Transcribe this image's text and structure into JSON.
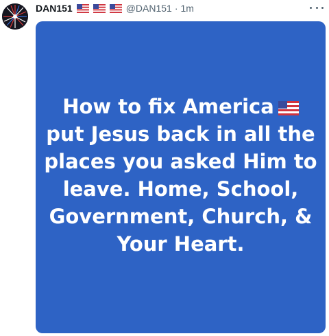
{
  "tweet": {
    "display_name": "DAN151",
    "name_badges": [
      "us-flag-icon",
      "us-flag-icon",
      "us-flag-icon"
    ],
    "handle": "@DAN151",
    "separator": "·",
    "timestamp": "1m",
    "more_icon": "more-horizontal-icon",
    "avatar_icon": "fireworks-avatar"
  },
  "media": {
    "background_color": "#2e63c5",
    "text_color": "#ffffff",
    "lines": [
      "How to fix America",
      "put Jesus back in all the",
      "places you asked Him to",
      "leave. Home, School,",
      "Government, Church, &",
      "Your Heart."
    ],
    "line_1_suffix_icon": "us-flag-icon"
  }
}
